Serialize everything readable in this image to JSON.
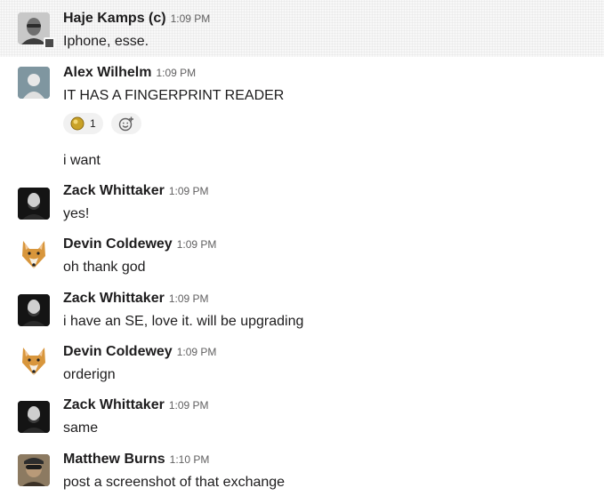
{
  "messages": [
    {
      "name": "Haje Kamps (c)",
      "time": "1:09 PM",
      "text": "Iphone, esse.",
      "avatar_icon": "user-photo-haje"
    },
    {
      "name": "Alex Wilhelm",
      "time": "1:09 PM",
      "text": "IT HAS A FINGERPRINT READER",
      "avatar_icon": "user-photo-alex"
    },
    {
      "text": "i want"
    },
    {
      "name": "Zack Whittaker",
      "time": "1:09 PM",
      "text": "yes!",
      "avatar_icon": "user-photo-zack"
    },
    {
      "name": "Devin Coldewey",
      "time": "1:09 PM",
      "text": "oh thank god",
      "avatar_icon": "dog-face-avatar"
    },
    {
      "name": "Zack Whittaker",
      "time": "1:09 PM",
      "text": "i have an SE, love it. will be upgrading",
      "avatar_icon": "user-photo-zack"
    },
    {
      "name": "Devin Coldewey",
      "time": "1:09 PM",
      "text": "orderign",
      "avatar_icon": "dog-face-avatar"
    },
    {
      "name": "Zack Whittaker",
      "time": "1:09 PM",
      "text": "same",
      "avatar_icon": "user-photo-zack"
    },
    {
      "name": "Matthew Burns",
      "time": "1:10 PM",
      "text": "post a screenshot of that exchange",
      "avatar_icon": "user-photo-matthew"
    }
  ],
  "reactions": {
    "emoji_icon": "gold-coin-emoji",
    "count": "1",
    "add_icon": "add-emoji-icon"
  },
  "colors": {
    "highlight_bg": "#f8f8f8",
    "timestamp": "#616061",
    "text": "#1d1c1d",
    "reaction_bg": "#f1f1f1"
  }
}
